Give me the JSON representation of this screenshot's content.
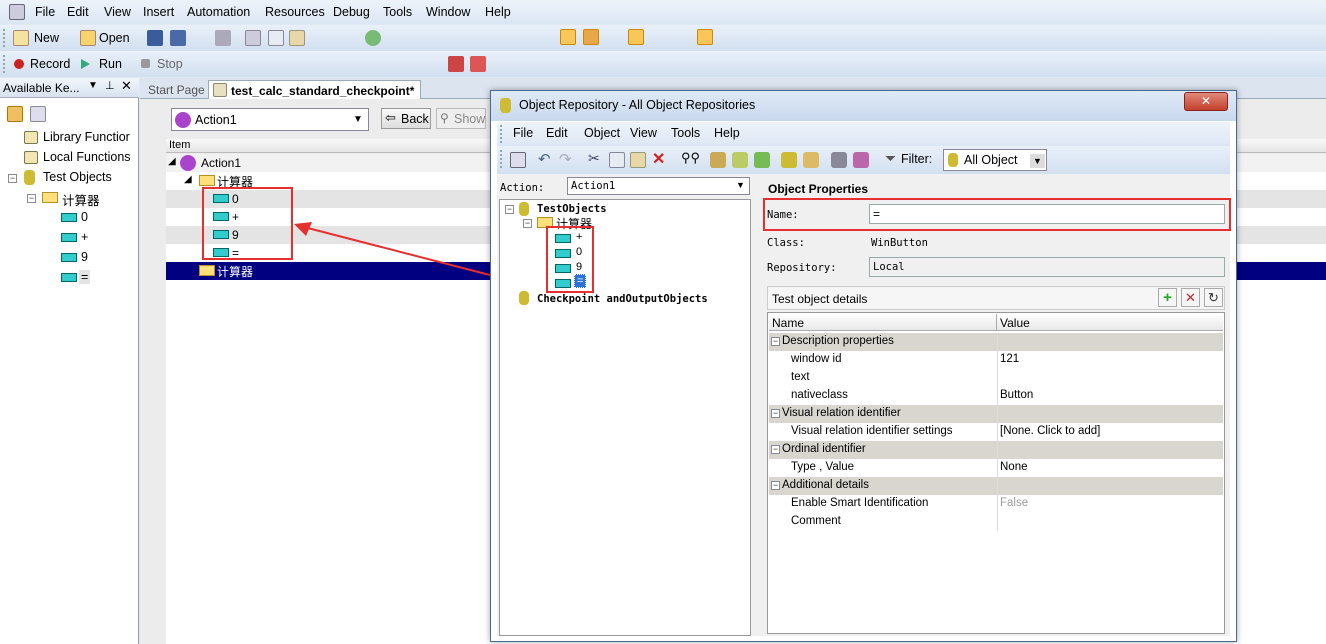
{
  "menubar": {
    "items": [
      "File",
      "Edit",
      "View",
      "Insert",
      "Automation",
      "Resources",
      "Debug",
      "Tools",
      "Window",
      "Help"
    ]
  },
  "toolbar1": {
    "new": "New",
    "open": "Open"
  },
  "toolbar2": {
    "record": "Record",
    "run": "Run",
    "stop": "Stop"
  },
  "left_pane": {
    "title": "Available Ke...",
    "items": [
      "Library Functior",
      "Local Functions",
      "Test Objects",
      "计算器",
      "0",
      "+",
      "9",
      "="
    ]
  },
  "doc_tabs": [
    "Start Page",
    "test_calc_standard_checkpoint*"
  ],
  "action_bar": {
    "action": "Action1",
    "back": "Back",
    "show": "Show"
  },
  "keyword_grid": {
    "header": "Item",
    "rows": [
      "Action1",
      "计算器",
      "0",
      "+",
      "9",
      "=",
      "计算器"
    ]
  },
  "dialog": {
    "title": "Object Repository - All Object Repositories",
    "menu": [
      "File",
      "Edit",
      "Object",
      "View",
      "Tools",
      "Help"
    ],
    "filter_label": "Filter:",
    "filter_value": "All Object",
    "action_label": "Action:",
    "action_value": "Action1",
    "tree": {
      "root": "TestObjects",
      "window": "计算器",
      "items": [
        "+",
        "0",
        "9",
        "="
      ],
      "checkpoints": "Checkpoint andOutputObjects"
    },
    "props_title": "Object Properties",
    "name_label": "Name:",
    "name_value": "=",
    "class_label": "Class:",
    "class_value": "WinButton",
    "repo_label": "Repository:",
    "repo_value": "Local",
    "details_title": "Test object details",
    "col_name": "Name",
    "col_value": "Value",
    "rows": [
      {
        "name": "Description properties",
        "value": "",
        "cat": true
      },
      {
        "name": "window id",
        "value": "121",
        "cat": false
      },
      {
        "name": "text",
        "value": "",
        "cat": false
      },
      {
        "name": "nativeclass",
        "value": "Button",
        "cat": false
      },
      {
        "name": "Visual relation identifier",
        "value": "",
        "cat": true
      },
      {
        "name": "Visual relation identifier settings",
        "value": "[None. Click to add]",
        "cat": false
      },
      {
        "name": "Ordinal identifier",
        "value": "",
        "cat": true
      },
      {
        "name": "Type , Value",
        "value": "None",
        "cat": false
      },
      {
        "name": "Additional details",
        "value": "",
        "cat": true
      },
      {
        "name": "Enable Smart Identification",
        "value": "False",
        "cat": false,
        "grey": true
      },
      {
        "name": "Comment",
        "value": "",
        "cat": false
      }
    ]
  },
  "colors": {
    "accent_red": "#e63030",
    "selection": "#000080"
  }
}
